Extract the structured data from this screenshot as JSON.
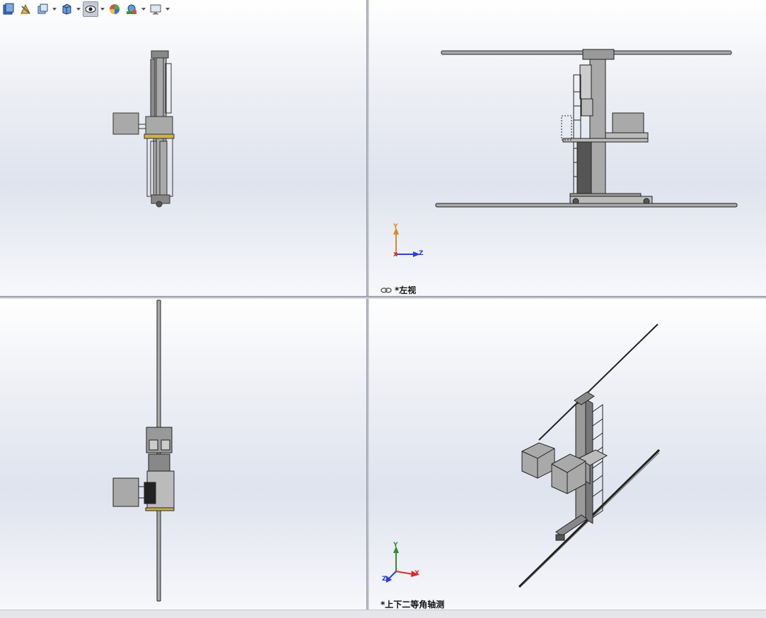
{
  "toolbar": {
    "buttons": [
      {
        "name": "view-orientation-icon",
        "dropdown": false
      },
      {
        "name": "section-view-icon",
        "dropdown": false
      },
      {
        "name": "zoom-area-icon",
        "dropdown": true
      },
      {
        "name": "display-style-icon",
        "dropdown": true
      },
      {
        "name": "hide-show-items-icon",
        "dropdown": true,
        "active": true
      },
      {
        "name": "edit-appearance-icon",
        "dropdown": false
      },
      {
        "name": "apply-scene-icon",
        "dropdown": true
      },
      {
        "name": "view-settings-icon",
        "dropdown": true
      }
    ]
  },
  "views": {
    "top_right": {
      "label": "*左视",
      "axes": {
        "vertical": "Y",
        "horizontal": "Z",
        "origin": "X"
      }
    },
    "bottom_right": {
      "label": "*上下二等角轴测",
      "axes": {
        "vertical": "Y",
        "horizontal": "X",
        "depth": "Z"
      }
    }
  },
  "colors": {
    "part_fill": "#a9a9a9",
    "part_dark": "#3a3a3a",
    "accent_yellow": "#c9b34a",
    "axis_y": "#d98b2a",
    "axis_y_iso": "#2f8f2f",
    "axis_z": "#2a3fd9",
    "axis_x": "#d92a2a"
  }
}
